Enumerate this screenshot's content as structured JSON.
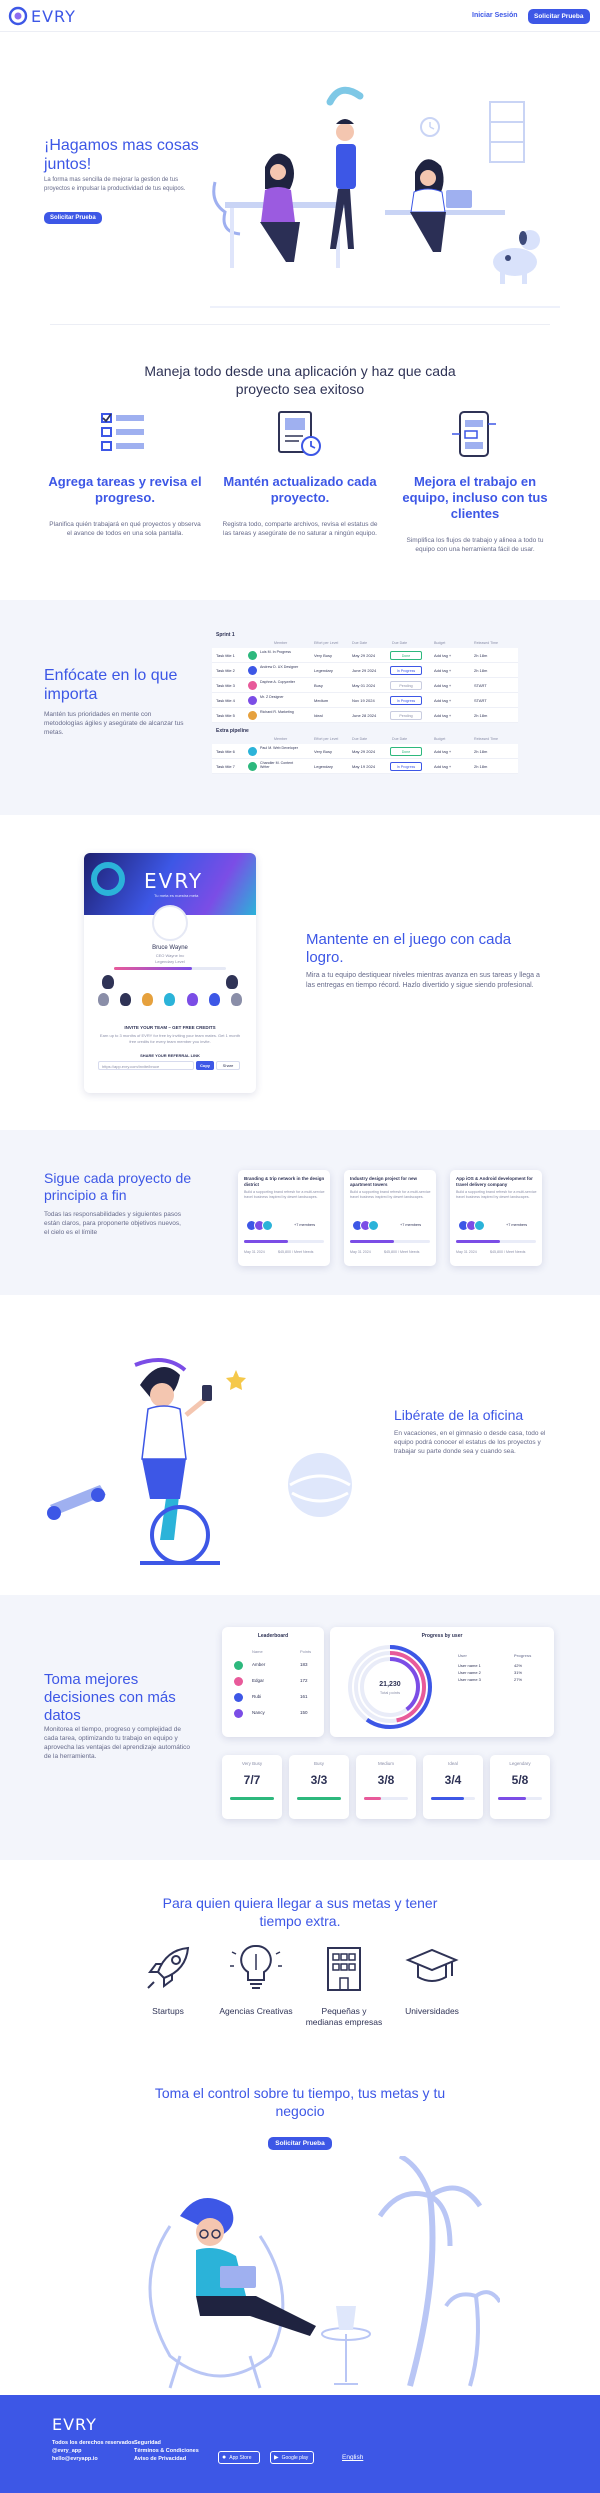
{
  "header": {
    "logo_text": "EVRY",
    "login_label": "Iniciar Sesión",
    "trial_label": "Solicitar Prueba"
  },
  "hero": {
    "title": "¡Hagamos mas cosas juntos!",
    "text": "La forma mas sencilla de mejorar la gestion de tus proyectos e impulsar la productividad de tus equipos.",
    "cta": "Solicitar Prueba"
  },
  "features": {
    "title": "Maneja todo desde una aplicación y haz que cada proyecto sea exitoso",
    "items": [
      {
        "icon": "task-list-icon",
        "title": "Agrega tareas y revisa el progreso.",
        "text": "Planifica quién trabajará en qué proyectos y observa el avance de todos en una sola pantalla."
      },
      {
        "icon": "document-clock-icon",
        "title": "Mantén actualizado cada proyecto.",
        "text": "Registra todo, comparte archivos, revisa el estatus de las tareas y asegúrate de no saturar a ningún equipo."
      },
      {
        "icon": "workflow-phone-icon",
        "title": "Mejora el trabajo en equipo, incluso con tus clientes",
        "text": "Simplifica los flujos de trabajo y alinea a todo tu equipo con una herramienta fácil de usar."
      }
    ]
  },
  "focus": {
    "title": "Enfócate en lo que importa",
    "text": "Mantén tus prioridades en mente con metodologías ágiles y asegúrate de alcanzar tus metas.",
    "table1_label": "Sprint 1",
    "table2_label": "Extra pipeline",
    "columns": [
      "Member",
      "Effort per Level",
      "Due Date",
      "Due Date",
      "Budget",
      "Released Time"
    ],
    "rows1": [
      [
        "Task title 1",
        "Luis M. In Progress",
        "Very Busy",
        "May 29 2024",
        "Done",
        "Add tag +",
        "2h 18m"
      ],
      [
        "Task title 2",
        "Andrew D. UX Designer",
        "Legendary",
        "June 29 2024",
        "In Progress",
        "Add tag +",
        "2h 18m"
      ],
      [
        "Task title 3",
        "Daphne A. Copywriter",
        "Busy",
        "May 01 2024",
        "Pending",
        "Add tag +",
        "START"
      ],
      [
        "Task title 4",
        "Mr. Z Designer",
        "Medium",
        "Nov 19 2024",
        "In Progress",
        "Add tag +",
        "START"
      ],
      [
        "Task title 5",
        "Richard R. Marketing",
        "Ideal",
        "June 28 2024",
        "Pending",
        "Add tag +",
        "2h 18m"
      ]
    ],
    "rows2": [
      [
        "Task title 6",
        "Paul M. Web Developer",
        "Very Busy",
        "May 29 2024",
        "Done",
        "Add tag +",
        "2h 18m"
      ],
      [
        "Task title 7",
        "Chandler M. Content Writer",
        "Legendary",
        "May 19 2024",
        "In Progress",
        "Add tag +",
        "2h 18m"
      ]
    ]
  },
  "game": {
    "title": "Mantente en el juego con cada logro.",
    "text": "Mira a tu equipo destiquear niveles mientras avanza en sus tareas y llega a las entregas en tiempo récord. Hazlo divertido y sigue siendo profesional.",
    "card_logo": "EVRY",
    "card_tagline": "Tu meta es nuestra meta",
    "profile_name": "Bruce Wayne",
    "profile_role": "CEO Wayne Inc",
    "profile_level": "Legendary Level",
    "invite_title": "INVITE YOUR TEAM – GET FREE CREDITS",
    "invite_text": "Earn up to 3 months of EVRY for free by inviting your team mates. Get 1 month free credits for every team member you invite.",
    "link_label": "SHARE YOUR REFERRAL LINK",
    "link_value": "https://app.evry.com/invite/bruce",
    "copy_label": "Copy",
    "share_label": "Share"
  },
  "projects": {
    "title": "Sigue cada proyecto de principio a fin",
    "text": "Todas las responsabilidades y siguientes pasos están claros, para proponerte objetivos nuevos, el cielo es el límite",
    "cards": [
      {
        "title": "Branding & trip network in the design district",
        "text": "Build a supporting brand refresh for a multi-service travel business inspired by desert landscapes.",
        "members": "+7 members",
        "date": "May 31 2024",
        "value": "$45,800 / Meet Needs"
      },
      {
        "title": "Industry design project for new apartment towers",
        "text": "Build a supporting brand refresh for a multi-service travel business inspired by desert landscapes.",
        "members": "+7 members",
        "date": "May 31 2024",
        "value": "$45,800 / Meet Needs"
      },
      {
        "title": "App iOS & Android development for travel delivery company",
        "text": "Build a supporting brand refresh for a multi-service travel business inspired by desert landscapes.",
        "members": "+7 members",
        "date": "May 31 2024",
        "value": "$45,800 / Meet Needs"
      }
    ]
  },
  "office": {
    "title": "Libérate de la oficina",
    "text": "En vacaciones, en el gimnasio o desde casa, todo el equipo podrá conocer el estatus de los proyectos y trabajar su parte donde sea y cuando sea."
  },
  "decisions": {
    "title": "Toma mejores decisiones con más datos",
    "text": "Monitorea el tiempo, progreso y complejidad de cada tarea, optimizando tu trabajo en equipo y aprovecha las ventajas del aprendizaje automático de la herramienta.",
    "leaderboard_title": "Leaderboard",
    "leaderboard_headers": [
      "Name",
      "Points"
    ],
    "leaderboard_rows": [
      {
        "name": "Amber",
        "points": "183"
      },
      {
        "name": "Edgar",
        "points": "172"
      },
      {
        "name": "Rubi",
        "points": "161"
      },
      {
        "name": "Nancy",
        "points": "150"
      }
    ],
    "progress_title": "Progress by user",
    "progress_value": "21,230",
    "progress_sub": "Total points",
    "progress_headers": [
      "User",
      "Progress"
    ],
    "progress_rows": [
      {
        "user": "User name 1",
        "value": "42%"
      },
      {
        "user": "User name 2",
        "value": "31%"
      },
      {
        "user": "User name 3",
        "value": "27%"
      }
    ],
    "stats": [
      {
        "label": "Very Busy",
        "value": "7/7",
        "color": "#2db87d",
        "progress": 1.0
      },
      {
        "label": "Busy",
        "value": "3/3",
        "color": "#2db87d",
        "progress": 1.0
      },
      {
        "label": "Medium",
        "value": "3/8",
        "color": "#e85a9a",
        "progress": 0.375
      },
      {
        "label": "Ideal",
        "value": "3/4",
        "color": "#3d57e6",
        "progress": 0.75
      },
      {
        "label": "Legendary",
        "value": "5/8",
        "color": "#7b4de6",
        "progress": 0.625
      }
    ]
  },
  "audience": {
    "title": "Para quien quiera llegar a sus metas y tener tiempo extra.",
    "items": [
      {
        "icon": "rocket-icon",
        "label": "Startups"
      },
      {
        "icon": "lightbulb-icon",
        "label": "Agencias Creativas"
      },
      {
        "icon": "building-icon",
        "label": "Pequeñas y medianas empresas"
      },
      {
        "icon": "graduation-cap-icon",
        "label": "Universidades"
      }
    ]
  },
  "control": {
    "title": "Toma el control sobre tu tiempo, tus metas y tu negocio",
    "cta": "Solicitar Prueba"
  },
  "footer": {
    "logo_text": "EVRY",
    "col1": [
      "Todos los derechos reservados",
      "@evry_app",
      "hello@evryapp.io"
    ],
    "col2": [
      "Seguridad",
      "Términos & Condiciones",
      "Aviso de Privacidad"
    ],
    "appstore": "App Store",
    "googleplay": "Google play",
    "language": "English"
  },
  "colors": {
    "brand": "#3d57e6",
    "footer_bg": "#3d57e6",
    "section_bg": "#f3f5fb"
  }
}
